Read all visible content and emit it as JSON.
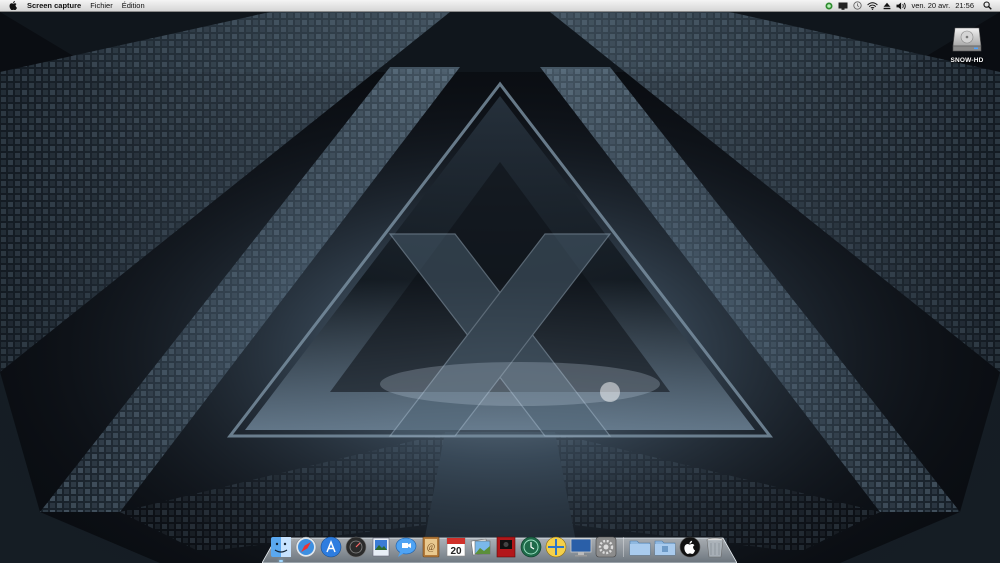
{
  "menubar": {
    "apple_icon": "apple-logo-icon",
    "app_name": "Screen capture",
    "menus": [
      "Fichier",
      "Édition"
    ],
    "status_icons": [
      "evernote-icon",
      "display-icon",
      "time-machine-icon",
      "wifi-icon",
      "eject-icon",
      "volume-icon"
    ],
    "date": "ven. 20 avr.",
    "time": "21:56",
    "search_icon": "spotlight-search-icon"
  },
  "desktop": {
    "drive_label": "SNOW-HD"
  },
  "dock": {
    "calendar_day": "20",
    "apps": [
      "Finder",
      "Safari",
      "App Store",
      "Dashboard",
      "Preview",
      "iChat",
      "Address Book",
      "iCal",
      "iPhoto",
      "Photo Booth",
      "Time Machine",
      "Directory Utility",
      "Display",
      "System Preferences"
    ],
    "folders": [
      "Applications",
      "Documents",
      "Apple",
      "Trash"
    ]
  },
  "colors": {
    "menubar_top": "#f4f4f4",
    "menubar_bottom": "#d6d6d6",
    "wallpaper_base": "#0a0d12",
    "wallpaper_glow": "#7f95a8"
  }
}
